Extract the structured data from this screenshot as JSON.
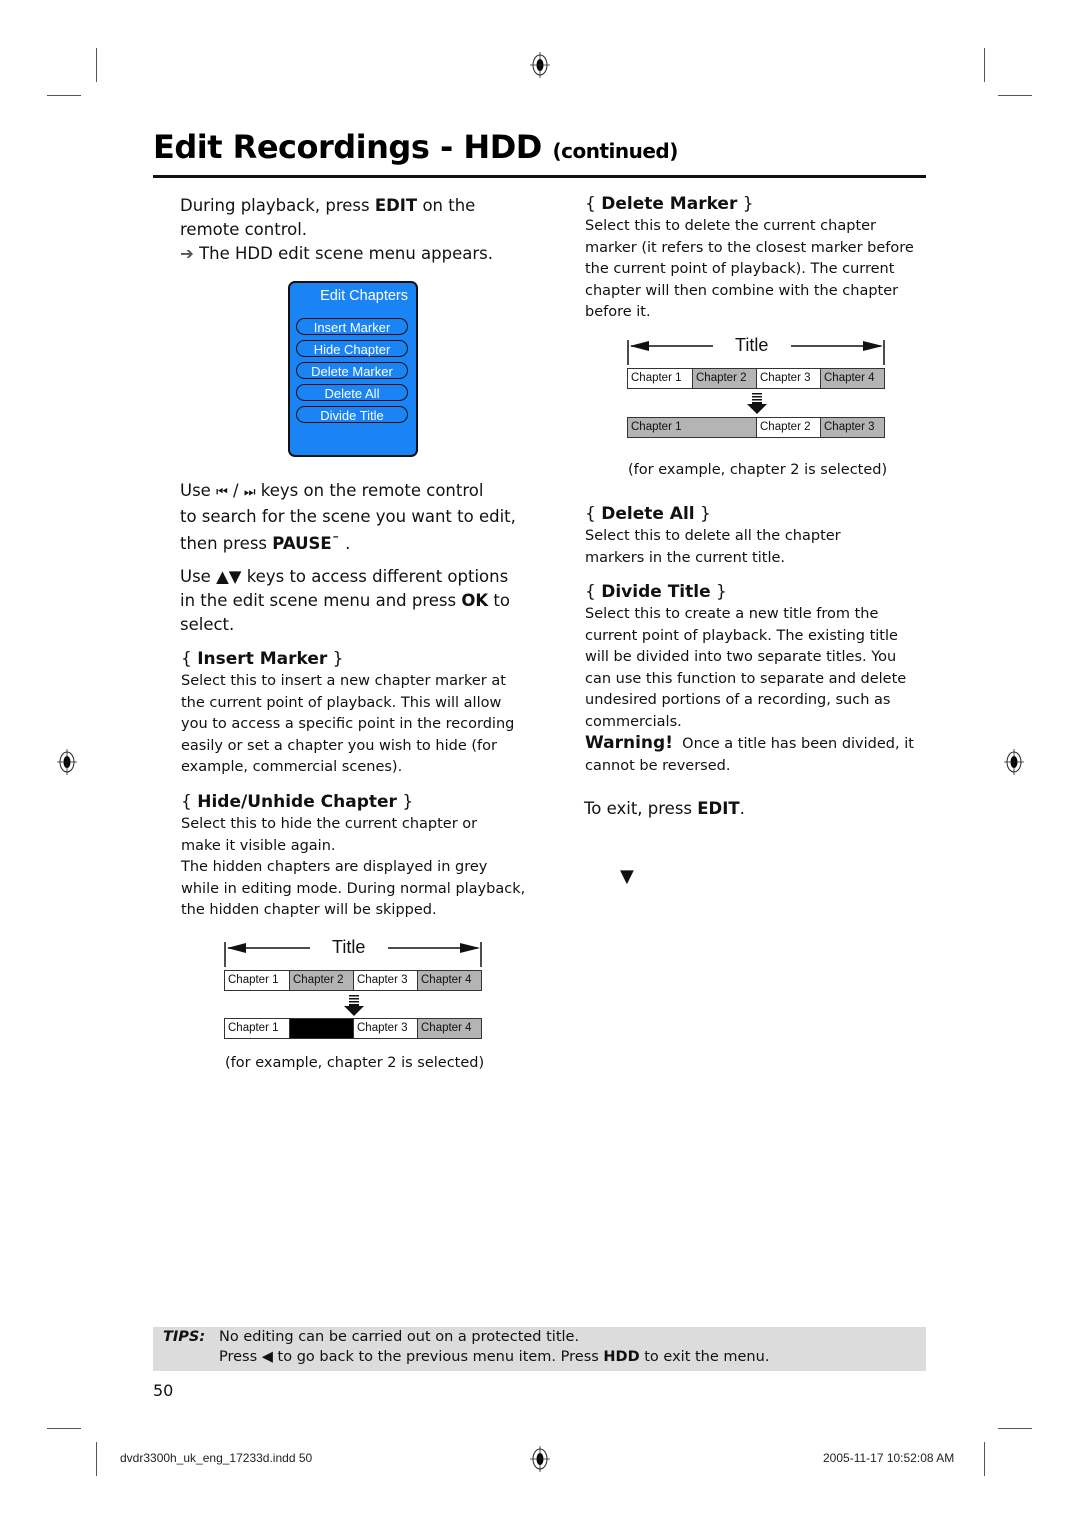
{
  "page": {
    "title": "Edit Recordings - HDD",
    "title_suffix": "(continued)",
    "page_number": "50"
  },
  "intro": {
    "line1_pre": "During playback, press ",
    "line1_bold": "EDIT",
    "line1_post": " on the",
    "line2": "remote control.",
    "result_arrow": "➔",
    "result_text": "The HDD edit scene menu appears."
  },
  "osd_menu": {
    "title": "Edit Chapters",
    "items": [
      "Insert Marker",
      "Hide Chapter",
      "Delete Marker",
      "Delete All",
      "Divide Title"
    ],
    "background_color": "#1a84f5"
  },
  "instructions": {
    "search_pre": "Use ",
    "search_prev_icon": "⏮",
    "search_sep": " / ",
    "search_next_icon": "⏭",
    "search_line1_post": " keys on the remote control",
    "search_line2": "to search for the scene you want to edit,",
    "search_line3_pre": "then press ",
    "search_line3_bold": "PAUSE",
    "search_line3_post": "ˉ    .",
    "nav_pre": "Use ",
    "nav_icons": "▲▼",
    "nav_line1_post": " keys to access different options",
    "nav_line2_pre": "in the edit scene menu and press ",
    "nav_line2_bold": "OK",
    "nav_line2_post": " to",
    "nav_line3": "select."
  },
  "sections": {
    "insert_marker": {
      "heading": "Insert Marker",
      "lines": [
        "Select this to insert a new chapter marker at",
        "the current point of playback. This will allow",
        "you to access a specific point in the recording",
        "easily or set a chapter you wish to hide (for",
        "example, commercial scenes)."
      ]
    },
    "hide_chapter": {
      "heading": "Hide/Unhide Chapter",
      "lines": [
        "Select this to hide the current chapter or",
        "make it visible again.",
        "The hidden chapters are displayed in grey",
        "while in editing mode. During normal playback,",
        "the hidden chapter will be skipped."
      ]
    },
    "delete_marker": {
      "heading": "Delete Marker",
      "lines": [
        "Select this to delete the current chapter",
        "marker (it refers to the closest marker before",
        "the current point of playback). The current",
        "chapter will then combine with the chapter",
        "before it."
      ]
    },
    "delete_all": {
      "heading": "Delete All",
      "lines": [
        "Select this to delete all the chapter",
        "markers in the current title."
      ]
    },
    "divide_title": {
      "heading": "Divide Title",
      "lines": [
        "Select this to create a new title from the",
        "current point of playback.  The existing title",
        "will be divided into two separate titles.  You",
        "can use this function to separate and delete",
        "undesired portions of a recording, such as",
        "commercials."
      ],
      "warning_label": "Warning!",
      "warning_line1": "  Once a title has been divided, it",
      "warning_line2": "cannot be reversed."
    },
    "exit": {
      "pre": "To exit, press ",
      "bold": "EDIT",
      "post": "."
    }
  },
  "diagram_hide": {
    "title": "Title",
    "before": [
      {
        "label": "Chapter 1",
        "state": "white"
      },
      {
        "label": "Chapter 2",
        "state": "grey"
      },
      {
        "label": "Chapter 3",
        "state": "white"
      },
      {
        "label": "Chapter 4",
        "state": "grey"
      }
    ],
    "after": [
      {
        "label": "Chapter 1",
        "state": "white"
      },
      {
        "label": "",
        "state": "black"
      },
      {
        "label": "Chapter 3",
        "state": "white"
      },
      {
        "label": "Chapter 4",
        "state": "grey"
      }
    ],
    "caption": "(for example, chapter 2 is selected)"
  },
  "diagram_delete": {
    "title": "Title",
    "before": [
      {
        "label": "Chapter 1",
        "state": "white"
      },
      {
        "label": "Chapter 2",
        "state": "grey"
      },
      {
        "label": "Chapter 3",
        "state": "white"
      },
      {
        "label": "Chapter 4",
        "state": "grey"
      }
    ],
    "after": [
      {
        "label": "Chapter 1",
        "state": "grey"
      },
      {
        "label": "Chapter 2",
        "state": "white"
      },
      {
        "label": "Chapter 3",
        "state": "grey"
      }
    ],
    "caption": "(for example, chapter 2 is selected)"
  },
  "continue_marker": "▼",
  "tips": {
    "label": "TIPS:",
    "line1": "No editing can be carried out on a protected title.",
    "line2_pre": "Press ",
    "line2_icon": "◀",
    "line2_mid": " to go back to the previous menu item. Press ",
    "line2_bold": "HDD",
    "line2_post": " to exit the menu."
  },
  "footer": {
    "file": "dvdr3300h_uk_eng_17233d.indd   50",
    "timestamp": "2005-11-17   10:52:08 AM"
  }
}
